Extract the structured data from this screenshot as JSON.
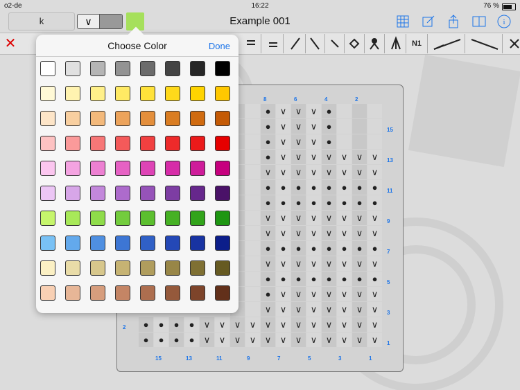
{
  "status_bar": {
    "carrier": "o2-de",
    "time": "16:22",
    "battery": "76 %"
  },
  "nav": {
    "field_value": "k",
    "title": "Example 001",
    "accent": "#a6e05c"
  },
  "toolbar": {
    "n1_label": "N1"
  },
  "chart": {
    "left_label": "2",
    "top_labels": [
      "8",
      "6",
      "4",
      "2"
    ],
    "bottom_labels": [
      "15",
      "13",
      "11",
      "9",
      "7",
      "5",
      "3",
      "1"
    ],
    "right_labels": [
      "15",
      "13",
      "11",
      "9",
      "7",
      "5",
      "3",
      "1"
    ],
    "rows": [
      "..oVVVo...",
      "..oVVVo...",
      "..oVVVo...",
      "..oVVVVVVV",
      "..VVVVVVVV",
      "..oooooooo",
      "..oooooooo",
      "..VVVVVVVV",
      "..VVVVVVVV",
      "..oooooooo",
      "..VVVVVVVV",
      "..oooooooo",
      "..oVVVVVVV",
      "..VVVVVVVV",
      "ooooVVVVVVVVVVVV",
      "ooooVVVVVVVVVVVV"
    ]
  },
  "color_popover": {
    "title": "Choose Color",
    "done_label": "Done",
    "colors": [
      [
        "#ffffff",
        "#e0e0e0",
        "#b5b5b5",
        "#939393",
        "#6b6b6b",
        "#444444",
        "#262626",
        "#000000"
      ],
      [
        "#fff9d6",
        "#fff3b0",
        "#fff08a",
        "#ffea64",
        "#ffe23a",
        "#ffd91b",
        "#ffd400",
        "#ffc800"
      ],
      [
        "#fde5c8",
        "#f8cfa0",
        "#f3b97b",
        "#eca35b",
        "#e48f3c",
        "#da7d22",
        "#d06b10",
        "#c45a05"
      ],
      [
        "#fdc2c2",
        "#fb9a9a",
        "#f77777",
        "#f45a5a",
        "#f14040",
        "#ee2a2a",
        "#eb1a1a",
        "#e60000"
      ],
      [
        "#fbc6ef",
        "#f4a3e1",
        "#ed80d2",
        "#e661c4",
        "#de44b6",
        "#d62ca8",
        "#ce1c9a",
        "#c6007e"
      ],
      [
        "#ecc6f5",
        "#d7a6e8",
        "#c388db",
        "#ad6bcc",
        "#9653b9",
        "#7d3da3",
        "#66278c",
        "#4a1268"
      ],
      [
        "#c6f56c",
        "#a8e959",
        "#8fdc4a",
        "#73cc3d",
        "#5cbf2f",
        "#46b124",
        "#32a41b",
        "#1e9612"
      ],
      [
        "#79c1f5",
        "#63a9ec",
        "#4f8fe1",
        "#3d76d4",
        "#3060c6",
        "#2448b6",
        "#1833a2",
        "#0c1e8a"
      ],
      [
        "#fbf0c4",
        "#e9dca8",
        "#d7c78c",
        "#c6b373",
        "#b09d5d",
        "#988647",
        "#7f7033",
        "#665a22"
      ],
      [
        "#f8d0b4",
        "#e7b697",
        "#d69d7d",
        "#c48565",
        "#ad6e4f",
        "#95593b",
        "#7d442a",
        "#62301a"
      ]
    ]
  }
}
